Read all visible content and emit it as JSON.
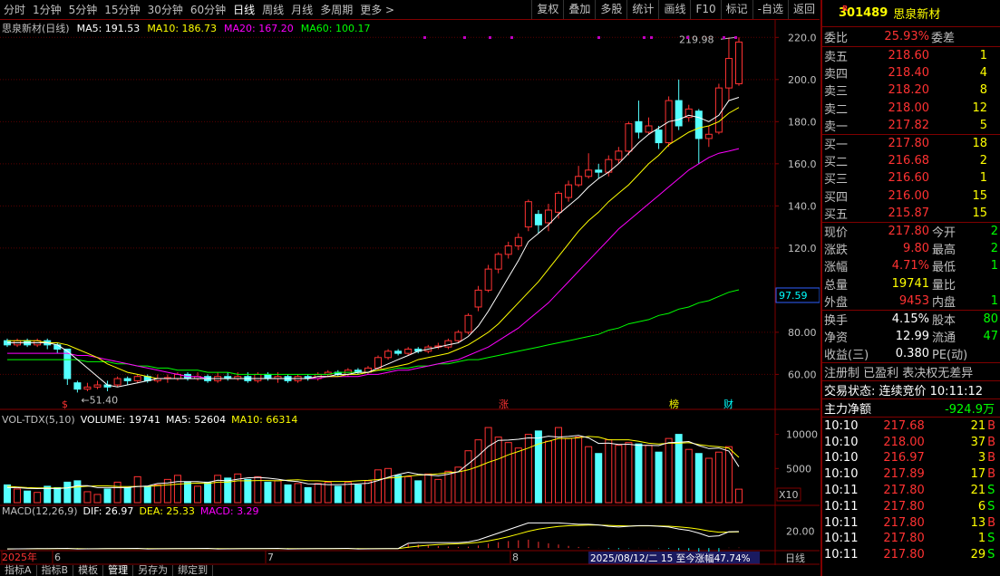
{
  "toolbar": {
    "periods": [
      "分时",
      "1分钟",
      "5分钟",
      "15分钟",
      "30分钟",
      "60分钟",
      "日线",
      "周线",
      "月线",
      "多周期",
      "更多 >"
    ],
    "active_period": "日线",
    "tools": [
      "复权",
      "叠加",
      "多股",
      "统计",
      "画线",
      "F10",
      "标记",
      "-自选",
      "返回"
    ]
  },
  "chart": {
    "ma_legend": {
      "name": "思泉新材(日线)",
      "items": [
        {
          "label": "MA5: 191.53",
          "color": "#ffffff"
        },
        {
          "label": "MA10: 186.73",
          "color": "#ffff00"
        },
        {
          "label": "MA20: 167.20",
          "color": "#ff00ff"
        },
        {
          "label": "MA60: 100.17",
          "color": "#00ff00"
        }
      ]
    },
    "price_axis": [
      "220.0",
      "200.0",
      "180.0",
      "160.0",
      "140.0",
      "120.0",
      "80.00",
      "60.00"
    ],
    "current_price_tag": "97.59",
    "high_label": "219.98",
    "low_label": "51.40",
    "markers": [
      {
        "text": "$",
        "color": "#ff3232"
      },
      {
        "text": "涨",
        "color": "#ff3232"
      },
      {
        "text": "榜",
        "color": "#ffff00"
      },
      {
        "text": "财",
        "color": "#00ffff"
      }
    ],
    "vol_legend": {
      "items": [
        {
          "label": "VOL-TDX(5,10)",
          "color": "#c0c0c0"
        },
        {
          "label": "VOLUME: 19741",
          "color": "#ffffff"
        },
        {
          "label": "MA5: 52604",
          "color": "#ffffff"
        },
        {
          "label": "MA10: 66314",
          "color": "#ffff00"
        }
      ]
    },
    "vol_axis": [
      "10000",
      "5000"
    ],
    "vol_unit": "X10",
    "macd_legend": {
      "items": [
        {
          "label": "MACD(12,26,9)",
          "color": "#c0c0c0"
        },
        {
          "label": "DIF: 26.97",
          "color": "#ffffff"
        },
        {
          "label": "DEA: 25.33",
          "color": "#ffff00"
        },
        {
          "label": "MACD: 3.29",
          "color": "#ff00ff"
        }
      ]
    },
    "macd_axis": [
      "20.00"
    ],
    "date_axis": [
      {
        "text": "2025年",
        "color": "#ff3232"
      },
      {
        "text": "6",
        "color": "#c0c0c0"
      },
      {
        "text": "7",
        "color": "#c0c0c0"
      },
      {
        "text": "8",
        "color": "#c0c0c0"
      }
    ],
    "range_info": "2025/08/12/二 15 至今涨幅47.74%",
    "period_label": "日线"
  },
  "chart_data": {
    "type": "candlestick",
    "title": "思泉新材(日线)",
    "ylim": [
      52,
      224
    ],
    "volume_unit": "X10",
    "candles": [
      {
        "o": 76,
        "c": 74,
        "h": 77,
        "l": 73,
        "v": 2600
      },
      {
        "o": 74,
        "c": 76,
        "h": 77,
        "l": 73,
        "v": 2000
      },
      {
        "o": 76,
        "c": 74,
        "h": 77,
        "l": 73,
        "v": 1700
      },
      {
        "o": 74,
        "c": 76,
        "h": 77,
        "l": 73,
        "v": 1500
      },
      {
        "o": 76,
        "c": 74,
        "h": 77,
        "l": 72,
        "v": 2400
      },
      {
        "o": 74,
        "c": 72,
        "h": 75,
        "l": 70,
        "v": 2200
      },
      {
        "o": 72,
        "c": 58,
        "h": 72,
        "l": 55,
        "v": 3000
      },
      {
        "o": 56,
        "c": 53,
        "h": 57,
        "l": 51.4,
        "v": 3200
      },
      {
        "o": 53,
        "c": 54,
        "h": 56,
        "l": 52,
        "v": 1600
      },
      {
        "o": 54,
        "c": 55,
        "h": 57,
        "l": 53,
        "v": 1200
      },
      {
        "o": 55,
        "c": 54,
        "h": 57,
        "l": 52,
        "v": 2000
      },
      {
        "o": 55,
        "c": 58,
        "h": 59,
        "l": 54,
        "v": 3000
      },
      {
        "o": 58,
        "c": 57,
        "h": 59,
        "l": 55,
        "v": 2200
      },
      {
        "o": 57,
        "c": 59,
        "h": 60,
        "l": 56,
        "v": 3800
      },
      {
        "o": 59,
        "c": 57,
        "h": 60,
        "l": 56,
        "v": 2400
      },
      {
        "o": 57,
        "c": 58,
        "h": 60,
        "l": 56,
        "v": 2600
      },
      {
        "o": 58,
        "c": 58.5,
        "h": 60,
        "l": 56,
        "v": 3400
      },
      {
        "o": 58,
        "c": 60,
        "h": 61,
        "l": 57,
        "v": 4000
      },
      {
        "o": 60,
        "c": 58,
        "h": 61,
        "l": 57,
        "v": 3000
      },
      {
        "o": 58,
        "c": 59,
        "h": 61,
        "l": 57,
        "v": 2400
      },
      {
        "o": 59,
        "c": 57,
        "h": 60,
        "l": 56,
        "v": 3000
      },
      {
        "o": 57,
        "c": 59,
        "h": 61,
        "l": 56,
        "v": 4000
      },
      {
        "o": 59,
        "c": 58,
        "h": 61,
        "l": 57,
        "v": 3600
      },
      {
        "o": 58,
        "c": 59,
        "h": 61,
        "l": 57,
        "v": 4200
      },
      {
        "o": 59,
        "c": 57,
        "h": 61,
        "l": 56,
        "v": 3400
      },
      {
        "o": 57,
        "c": 60,
        "h": 61,
        "l": 56,
        "v": 3800
      },
      {
        "o": 60,
        "c": 58,
        "h": 61,
        "l": 57,
        "v": 3000
      },
      {
        "o": 58,
        "c": 59,
        "h": 61,
        "l": 56,
        "v": 3200
      },
      {
        "o": 59,
        "c": 57,
        "h": 60,
        "l": 56,
        "v": 2600
      },
      {
        "o": 57,
        "c": 59,
        "h": 60,
        "l": 56,
        "v": 2800
      },
      {
        "o": 59,
        "c": 58,
        "h": 60,
        "l": 57,
        "v": 2200
      },
      {
        "o": 58,
        "c": 60,
        "h": 61,
        "l": 57,
        "v": 2800
      },
      {
        "o": 60,
        "c": 61,
        "h": 62,
        "l": 59,
        "v": 3000
      },
      {
        "o": 61,
        "c": 60,
        "h": 62,
        "l": 59,
        "v": 2400
      },
      {
        "o": 60,
        "c": 62,
        "h": 63,
        "l": 59,
        "v": 3000
      },
      {
        "o": 62,
        "c": 61,
        "h": 63,
        "l": 60,
        "v": 2600
      },
      {
        "o": 61,
        "c": 63,
        "h": 64,
        "l": 60,
        "v": 3200
      },
      {
        "o": 63,
        "c": 68,
        "h": 69,
        "l": 62,
        "v": 4800
      },
      {
        "o": 68,
        "c": 71,
        "h": 72,
        "l": 67,
        "v": 5000
      },
      {
        "o": 71,
        "c": 70,
        "h": 72,
        "l": 69,
        "v": 4000
      },
      {
        "o": 70,
        "c": 72,
        "h": 73,
        "l": 69,
        "v": 3800
      },
      {
        "o": 72,
        "c": 71,
        "h": 73,
        "l": 70,
        "v": 3200
      },
      {
        "o": 71,
        "c": 73,
        "h": 74,
        "l": 70,
        "v": 4200
      },
      {
        "o": 73,
        "c": 73.5,
        "h": 75,
        "l": 72,
        "v": 3400
      },
      {
        "o": 73,
        "c": 76,
        "h": 77,
        "l": 72,
        "v": 4600
      },
      {
        "o": 76,
        "c": 80,
        "h": 81,
        "l": 75,
        "v": 5200
      },
      {
        "o": 80,
        "c": 88,
        "h": 89,
        "l": 79,
        "v": 7600
      },
      {
        "o": 92,
        "c": 100,
        "h": 102,
        "l": 90,
        "v": 9200
      },
      {
        "o": 100,
        "c": 110,
        "h": 112,
        "l": 99,
        "v": 11000
      },
      {
        "o": 110,
        "c": 117,
        "h": 118,
        "l": 108,
        "v": 9600
      },
      {
        "o": 117,
        "c": 121,
        "h": 123,
        "l": 115,
        "v": 8800
      },
      {
        "o": 121,
        "c": 125,
        "h": 127,
        "l": 119,
        "v": 8000
      },
      {
        "o": 130,
        "c": 142,
        "h": 143,
        "l": 128,
        "v": 10000
      },
      {
        "o": 136,
        "c": 131,
        "h": 138,
        "l": 127,
        "v": 10500
      },
      {
        "o": 132,
        "c": 138,
        "h": 141,
        "l": 128,
        "v": 9000
      },
      {
        "o": 137,
        "c": 146,
        "h": 147,
        "l": 134,
        "v": 11000
      },
      {
        "o": 144,
        "c": 150,
        "h": 152,
        "l": 142,
        "v": 9400
      },
      {
        "o": 150,
        "c": 154,
        "h": 159,
        "l": 149,
        "v": 9600
      },
      {
        "o": 154,
        "c": 157,
        "h": 165,
        "l": 153,
        "v": 8200
      },
      {
        "o": 157,
        "c": 156,
        "h": 160,
        "l": 153,
        "v": 7200
      },
      {
        "o": 156,
        "c": 162,
        "h": 164,
        "l": 154,
        "v": 9200
      },
      {
        "o": 162,
        "c": 166,
        "h": 168,
        "l": 160,
        "v": 8400
      },
      {
        "o": 166,
        "c": 179,
        "h": 180,
        "l": 164,
        "v": 8800
      },
      {
        "o": 180,
        "c": 175,
        "h": 190,
        "l": 172,
        "v": 8600
      },
      {
        "o": 175,
        "c": 178,
        "h": 182,
        "l": 174,
        "v": 8400
      },
      {
        "o": 176,
        "c": 170,
        "h": 178,
        "l": 167,
        "v": 7400
      },
      {
        "o": 170,
        "c": 190,
        "h": 192,
        "l": 168,
        "v": 9400
      },
      {
        "o": 190,
        "c": 178,
        "h": 200,
        "l": 176,
        "v": 10000
      },
      {
        "o": 182,
        "c": 186,
        "h": 188,
        "l": 180,
        "v": 7800
      },
      {
        "o": 185,
        "c": 172,
        "h": 186,
        "l": 160,
        "v": 7200
      },
      {
        "o": 172,
        "c": 174,
        "h": 178,
        "l": 168,
        "v": 6500
      },
      {
        "o": 175,
        "c": 196,
        "h": 198,
        "l": 174,
        "v": 7400
      },
      {
        "o": 196,
        "c": 210,
        "h": 219.98,
        "l": 190,
        "v": 8200
      },
      {
        "o": 198,
        "c": 217.8,
        "h": 220,
        "l": 197,
        "v": 1974
      }
    ],
    "ma5": [
      75,
      75,
      75,
      75,
      75,
      74,
      71,
      67,
      63,
      59,
      55,
      54,
      55,
      56,
      57,
      58,
      58,
      58,
      58,
      58,
      58,
      58,
      58,
      58,
      58,
      58,
      58,
      58,
      58,
      58,
      58,
      59,
      59,
      60,
      60,
      61,
      61,
      63,
      65,
      67,
      69,
      71,
      72,
      73,
      74,
      75,
      78,
      83,
      90,
      98,
      106,
      114,
      123,
      127,
      131,
      136,
      140,
      144,
      149,
      153,
      156,
      160,
      165,
      170,
      174,
      177,
      180,
      181,
      183,
      182,
      180,
      183,
      190,
      191.53
    ],
    "ma10": [
      76,
      76,
      76,
      76,
      75,
      75,
      74,
      72,
      70,
      68,
      65,
      63,
      61,
      60,
      59,
      58,
      58,
      58,
      58,
      58,
      58,
      58,
      58,
      58,
      58,
      58,
      58,
      58,
      58,
      58,
      58,
      59,
      59,
      59,
      60,
      60,
      61,
      62,
      63,
      64,
      65,
      67,
      68,
      69,
      70,
      72,
      74,
      77,
      80,
      84,
      89,
      94,
      99,
      104,
      110,
      116,
      122,
      128,
      133,
      137,
      142,
      146,
      150,
      155,
      160,
      164,
      169,
      172,
      175,
      177,
      178,
      180,
      184,
      186.73
    ],
    "ma20": [
      70,
      70,
      70,
      70,
      70,
      70,
      70,
      69,
      69,
      68,
      67,
      66,
      65,
      64,
      63,
      62,
      61,
      60,
      59,
      59,
      58,
      58,
      58,
      58,
      58,
      58,
      58,
      58,
      58,
      58,
      58,
      58,
      59,
      59,
      59,
      59,
      60,
      60,
      61,
      62,
      62,
      63,
      64,
      65,
      66,
      67,
      69,
      71,
      73,
      76,
      79,
      82,
      86,
      90,
      94,
      99,
      104,
      109,
      114,
      119,
      124,
      129,
      133,
      137,
      141,
      145,
      149,
      153,
      157,
      160,
      163,
      165,
      166,
      167.2
    ],
    "ma60": [
      67,
      67,
      67,
      67,
      67,
      67,
      67,
      67,
      66,
      66,
      66,
      65,
      65,
      64,
      64,
      63,
      63,
      62,
      62,
      62,
      61,
      61,
      61,
      60,
      60,
      60,
      60,
      60,
      60,
      60,
      60,
      60,
      60,
      61,
      61,
      61,
      61,
      62,
      62,
      63,
      63,
      64,
      64,
      65,
      65,
      66,
      67,
      67,
      68,
      69,
      70,
      71,
      72,
      73,
      74,
      75,
      76,
      77,
      78,
      79,
      81,
      82,
      84,
      85,
      86,
      88,
      89,
      91,
      92,
      94,
      95,
      97,
      99,
      100.17
    ],
    "vol_ma5": [
      2200,
      2200,
      2100,
      2050,
      2100,
      2060,
      2160,
      2500,
      2480,
      2200,
      2200,
      2200,
      2200,
      2360,
      2440,
      2800,
      2880,
      3080,
      3080,
      3080,
      2960,
      3280,
      3200,
      3440,
      3640,
      3700,
      3600,
      3440,
      3200,
      3080,
      2760,
      2720,
      2640,
      2640,
      2680,
      2760,
      2840,
      3240,
      3720,
      4120,
      4440,
      4160,
      4040,
      3920,
      4160,
      4520,
      5680,
      6880,
      8240,
      9120,
      9160,
      9280,
      9480,
      9440,
      9740,
      9600,
      9700,
      9840,
      9480,
      8680,
      8720,
      8520,
      8560,
      8400,
      8400,
      8360,
      8800,
      8840,
      8960,
      8360,
      7920,
      8000,
      7560,
      5260
    ],
    "vol_ma10": [
      2400,
      2300,
      2200,
      2150,
      2150,
      2130,
      2180,
      2300,
      2400,
      2450,
      2450,
      2380,
      2360,
      2370,
      2370,
      2500,
      2600,
      2700,
      2800,
      2860,
      2800,
      3000,
      3000,
      3200,
      3200,
      3240,
      3240,
      3200,
      3300,
      3360,
      3220,
      3200,
      3100,
      3100,
      3100,
      3200,
      3260,
      3380,
      3600,
      3700,
      3900,
      4000,
      4100,
      4200,
      4400,
      4500,
      4800,
      5300,
      5900,
      6400,
      7000,
      7500,
      8000,
      8600,
      9000,
      9400,
      9400,
      9500,
      9700,
      9600,
      9200,
      9200,
      9200,
      9000,
      8700,
      8600,
      8700,
      8700,
      8800,
      8500,
      8300,
      8200,
      8000,
      6631
    ]
  },
  "quote": {
    "code": "301489",
    "name": "思泉新材",
    "weibi_label": "委比",
    "weibi": "25.93%",
    "weicha_label": "委差",
    "asks": [
      {
        "label": "卖五",
        "price": "218.60",
        "vol": "1"
      },
      {
        "label": "卖四",
        "price": "218.40",
        "vol": "4"
      },
      {
        "label": "卖三",
        "price": "218.20",
        "vol": "8"
      },
      {
        "label": "卖二",
        "price": "218.00",
        "vol": "12"
      },
      {
        "label": "卖一",
        "price": "217.82",
        "vol": "5"
      }
    ],
    "bids": [
      {
        "label": "买一",
        "price": "217.80",
        "vol": "18"
      },
      {
        "label": "买二",
        "price": "216.68",
        "vol": "2"
      },
      {
        "label": "买三",
        "price": "216.60",
        "vol": "1"
      },
      {
        "label": "买四",
        "price": "216.00",
        "vol": "15"
      },
      {
        "label": "买五",
        "price": "215.87",
        "vol": "15"
      }
    ],
    "stats": [
      {
        "l1": "现价",
        "v1": "217.80",
        "c1": "red",
        "l2": "今开",
        "v2": "2"
      },
      {
        "l1": "涨跌",
        "v1": "9.80",
        "c1": "red",
        "l2": "最高",
        "v2": "2"
      },
      {
        "l1": "涨幅",
        "v1": "4.71%",
        "c1": "red",
        "l2": "最低",
        "v2": "1"
      },
      {
        "l1": "总量",
        "v1": "19741",
        "c1": "yel",
        "l2": "量比",
        "v2": ""
      },
      {
        "l1": "外盘",
        "v1": "9453",
        "c1": "red",
        "l2": "内盘",
        "v2": "1"
      }
    ],
    "stats2": [
      {
        "l1": "换手",
        "v1": "4.15%",
        "c1": "white",
        "l2": "股本",
        "v2": "80"
      },
      {
        "l1": "净资",
        "v1": "12.99",
        "c1": "white",
        "l2": "流通",
        "v2": "47"
      },
      {
        "l1": "收益(三)",
        "v1": "0.380",
        "c1": "white",
        "l2": "PE(动)",
        "v2": ""
      }
    ],
    "tags": "注册制 已盈利 表决权无差异",
    "trade_status": "交易状态: 连续竞价 10:11:12",
    "main_flow_label": "主力净额",
    "main_flow_value": "-924.9万",
    "ticks": [
      {
        "t": "10:10",
        "p": "217.68",
        "n": "21",
        "s": "B",
        "c": "red"
      },
      {
        "t": "10:10",
        "p": "218.00",
        "n": "37",
        "s": "B",
        "c": "red"
      },
      {
        "t": "10:10",
        "p": "216.97",
        "n": "3",
        "s": "B",
        "c": "red"
      },
      {
        "t": "10:10",
        "p": "217.89",
        "n": "17",
        "s": "B",
        "c": "red"
      },
      {
        "t": "10:11",
        "p": "217.80",
        "n": "21",
        "s": "S",
        "c": "green"
      },
      {
        "t": "10:11",
        "p": "217.80",
        "n": "6",
        "s": "S",
        "c": "green"
      },
      {
        "t": "10:11",
        "p": "217.80",
        "n": "13",
        "s": "B",
        "c": "red"
      },
      {
        "t": "10:11",
        "p": "217.80",
        "n": "1",
        "s": "S",
        "c": "green"
      },
      {
        "t": "10:11",
        "p": "217.80",
        "n": "29",
        "s": "S",
        "c": "green"
      }
    ]
  },
  "bottom_tabs": [
    "指标A",
    "指标B",
    "模板",
    "管理",
    "另存为",
    "绑定到"
  ],
  "bottom_active": "管理"
}
